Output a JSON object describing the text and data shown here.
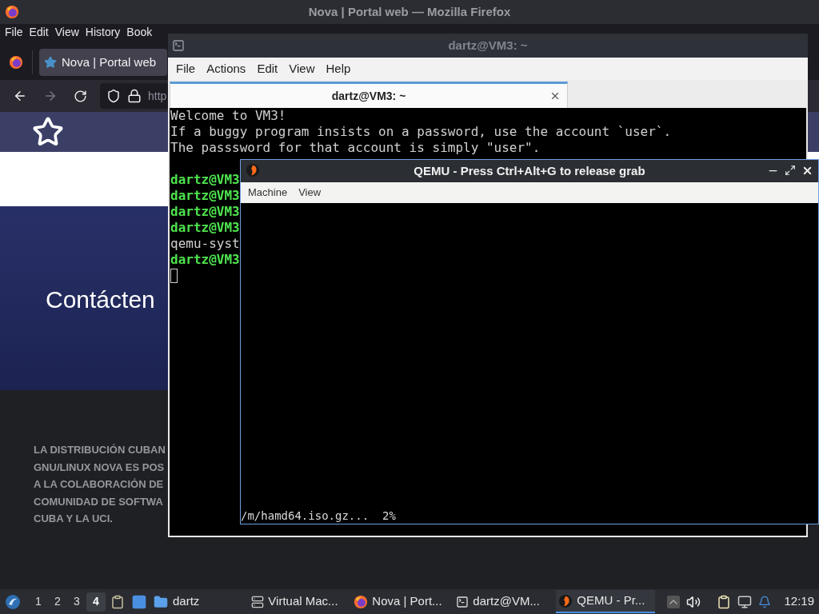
{
  "firefox": {
    "title": "Nova | Portal web — Mozilla Firefox",
    "menu": [
      "File",
      "Edit",
      "View",
      "History",
      "Book"
    ],
    "tab": "Nova | Portal web",
    "url": "http",
    "page": {
      "heading": "Contácten",
      "footer_lines": [
        "LA DISTRIBUCIÓN CUBAN",
        "GNU/LINUX NOVA ES POS",
        "A LA COLABORACIÓN DE",
        "COMUNIDAD DE SOFTWA",
        "CUBA Y LA UCI."
      ]
    }
  },
  "terminal": {
    "title": "dartz@VM3: ~",
    "menu": [
      "File",
      "Actions",
      "Edit",
      "View",
      "Help"
    ],
    "tab": {
      "label": "dartz@VM3: ~",
      "selected": true
    },
    "lines": [
      {
        "kind": "plain",
        "text": "Welcome to VM3!"
      },
      {
        "kind": "plain",
        "text": "If a buggy program insists on a password, use the account `user`."
      },
      {
        "kind": "plain",
        "text": "The passsword for that account is simply \"user\"."
      },
      {
        "kind": "blank"
      },
      {
        "kind": "prompt",
        "text": "dartz@VM3"
      },
      {
        "kind": "prompt",
        "text": "dartz@VM3"
      },
      {
        "kind": "prompt",
        "text": "dartz@VM3"
      },
      {
        "kind": "prompt",
        "text": "dartz@VM3"
      },
      {
        "kind": "plain",
        "text": "qemu-syst"
      },
      {
        "kind": "prompt",
        "text": "dartz@VM3"
      },
      {
        "kind": "cursor"
      }
    ]
  },
  "qemu": {
    "title": "QEMU - Press Ctrl+Alt+G to release grab",
    "menu": [
      "Machine",
      "View"
    ],
    "screen_text": "/m/hamd64.iso.gz...  2%"
  },
  "taskbar": {
    "workspaces": [
      {
        "label": "1",
        "selected": false
      },
      {
        "label": "2",
        "selected": false
      },
      {
        "label": "3",
        "selected": false
      },
      {
        "label": "4",
        "selected": true
      }
    ],
    "folder": "dartz",
    "tasks": [
      {
        "kind": "vm",
        "label": "Virtual Mac...",
        "selected": false
      },
      {
        "kind": "browser",
        "label": "Nova | Port...",
        "selected": false
      },
      {
        "kind": "terminal",
        "label": "dartz@VM...",
        "selected": false
      },
      {
        "kind": "qemu",
        "label": "QEMU - Pr...",
        "selected": true
      }
    ],
    "clock": "12:19"
  }
}
